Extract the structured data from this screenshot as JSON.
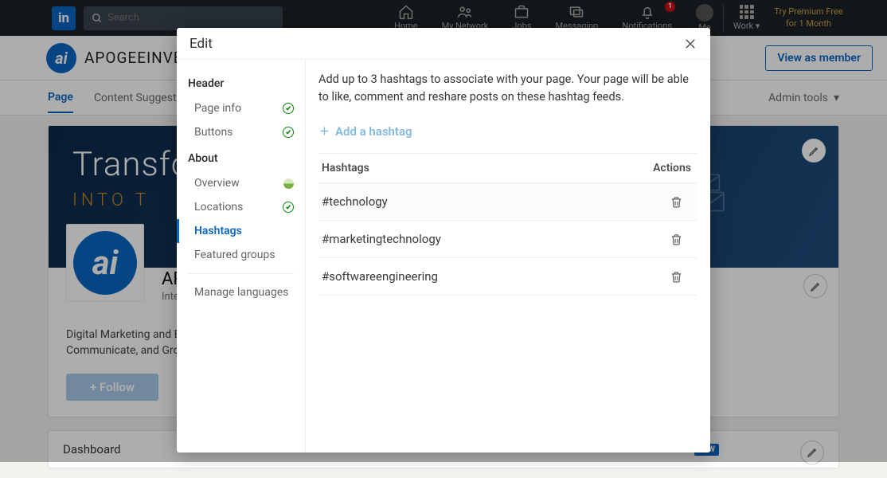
{
  "nav": {
    "search_placeholder": "Search",
    "items": [
      "Home",
      "My Network",
      "Jobs",
      "Messaging",
      "Notifications",
      "Me"
    ],
    "badge": "1",
    "work_label": "Work",
    "premium_line1": "Try Premium Free",
    "premium_line2": "for 1 Month"
  },
  "pageheader": {
    "company": "APOGEEINVENT",
    "view_btn": "View as member"
  },
  "tabs": {
    "page": "Page",
    "suggestions": "Content Suggestions",
    "admin_tools": "Admin tools"
  },
  "card": {
    "cover_headline": "Transfor",
    "cover_sub": "INTO T",
    "title": "APO",
    "subtitle": "Intern",
    "desc1": "Digital Marketing and B",
    "desc2": "Communicate, and Grow",
    "follow": "+  Follow"
  },
  "dashboard": {
    "title": "Dashboard",
    "new": "NEW"
  },
  "modal": {
    "title": "Edit",
    "sidebar": {
      "header_title": "Header",
      "page_info": "Page info",
      "buttons": "Buttons",
      "about_title": "About",
      "overview": "Overview",
      "locations": "Locations",
      "hashtags": "Hashtags",
      "featured": "Featured groups",
      "manage_lang": "Manage languages"
    },
    "main": {
      "intro": "Add up to 3 hashtags to associate with your page. Your page will be able to like, comment and reshare posts on these hashtag feeds.",
      "add_label": "Add a hashtag",
      "col_hashtags": "Hashtags",
      "col_actions": "Actions",
      "rows": [
        "#technology",
        "#marketingtechnology",
        "#softwareengineering"
      ]
    }
  }
}
